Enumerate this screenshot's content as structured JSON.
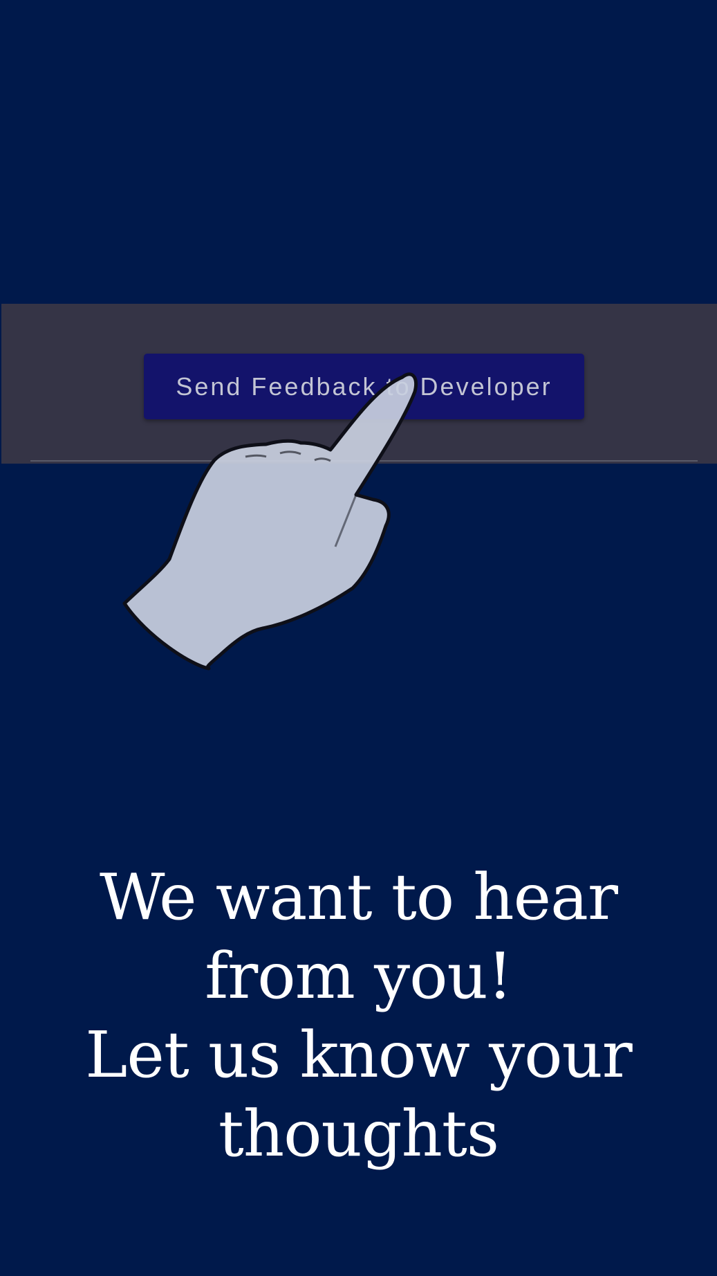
{
  "feedback": {
    "button_label": "Send Feedback to Developer"
  },
  "headline": {
    "lines": [
      "We want to hear",
      "from you!",
      "Let us know your",
      "thoughts"
    ]
  },
  "icons": {
    "pointer": "hand-pointer-icon"
  },
  "colors": {
    "background": "#00194b",
    "highlight_band": "#353446",
    "button": "#13136b",
    "button_text": "#c3c5d4",
    "hand_fill": "#c9cfdf",
    "headline_text": "#ffffff"
  }
}
